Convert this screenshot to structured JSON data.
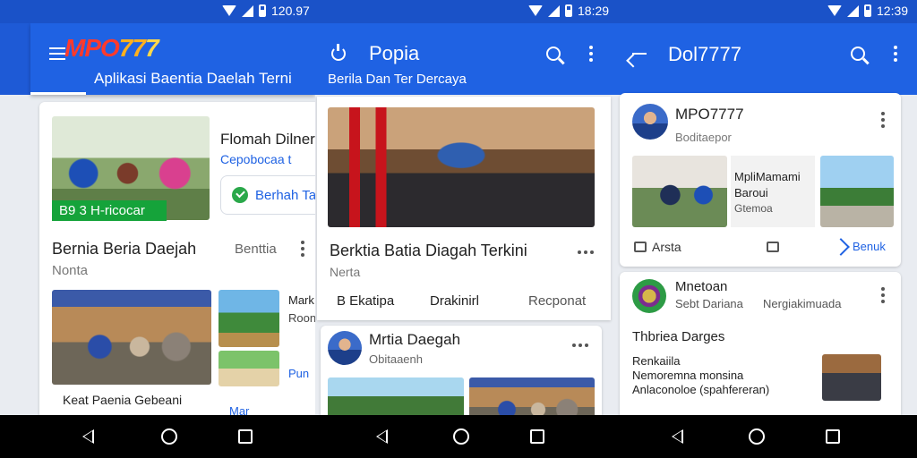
{
  "statusbar": {
    "times": [
      "120.97",
      "18:29",
      "12:39"
    ]
  },
  "panel1": {
    "logo": {
      "part1": "MPO",
      "part2": "77",
      "part3": "7"
    },
    "tagline": "Aplikasi Baentia Daelah Terni",
    "featured": {
      "badge": "B9 3 H-ricocar",
      "title": "Flomah Dilnera",
      "meta": "Cepobocaa t",
      "action": "Berhah Ta"
    },
    "section": {
      "title": "Bernia Beria Daejah",
      "more": "Benttia",
      "subtitle": "Nonta"
    },
    "story1": {
      "caption": "Keat Paenia Gebeani",
      "caption2": "Mar"
    },
    "side": {
      "title": "Mark",
      "line2": "Roon",
      "line3": "Pun"
    }
  },
  "panel2": {
    "title": "Popia",
    "subtitle": "Berila Dan Ter Dercaya",
    "headline": "Berktia Batia Diagah Terkini",
    "meta": "Nerta",
    "tabs": [
      "B Ekatipa",
      "Drakinirl",
      "Recponat"
    ],
    "post": {
      "author": "Mrtia Daegah",
      "sub": "Obitaaenh"
    }
  },
  "panel3": {
    "title": "Dol7777",
    "post1": {
      "author": "MPO7777",
      "sub": "Boditaepor",
      "inset_title": "MpliMamami",
      "inset_line2": "Baroui",
      "inset_line3": "Gtemoa",
      "action1": "Arsta",
      "action3": "Benuk"
    },
    "post2": {
      "author": "Mnetoan",
      "sub": "Sebt Dariana",
      "sub2": "Nergiakimuada",
      "heading": "Thbriea Darges",
      "lines": [
        "Renkaiila",
        "Nemoremna monsina",
        "Anlaconoloe (spahfereran)"
      ]
    }
  }
}
